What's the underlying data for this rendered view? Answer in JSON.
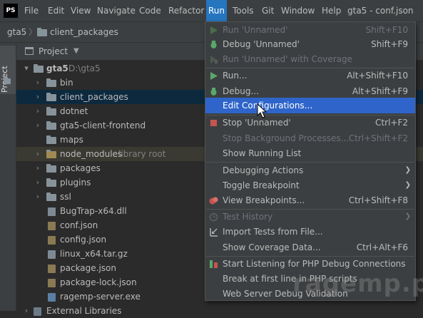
{
  "app": {
    "logo": "PS",
    "window_title": "gta5 - conf.json"
  },
  "menubar": [
    {
      "label": "File"
    },
    {
      "label": "Edit"
    },
    {
      "label": "View"
    },
    {
      "label": "Navigate"
    },
    {
      "label": "Code"
    },
    {
      "label": "Refactor"
    },
    {
      "label": "Run",
      "active": true
    },
    {
      "label": "Tools"
    },
    {
      "label": "Git"
    },
    {
      "label": "Window"
    },
    {
      "label": "Help"
    }
  ],
  "breadcrumb": {
    "root": "gta5",
    "child": "client_packages"
  },
  "side_strip": {
    "project_tab": "Project"
  },
  "project_panel": {
    "title": "Project"
  },
  "tree": [
    {
      "label": "gta5",
      "hint": "D:\\gta5",
      "type": "folder",
      "level": 0,
      "expanded": true
    },
    {
      "label": "bin",
      "type": "folder",
      "level": 1
    },
    {
      "label": "client_packages",
      "type": "folder",
      "level": 1,
      "selected": true
    },
    {
      "label": "dotnet",
      "type": "folder",
      "level": 1
    },
    {
      "label": "gta5-client-frontend",
      "type": "folder",
      "level": 1
    },
    {
      "label": "maps",
      "type": "folder",
      "level": 1,
      "no_arrow": true
    },
    {
      "label": "node_modules",
      "hint": "library root",
      "type": "folder",
      "level": 1,
      "excluded": true
    },
    {
      "label": "packages",
      "type": "folder",
      "level": 1
    },
    {
      "label": "plugins",
      "type": "folder",
      "level": 1
    },
    {
      "label": "ssl",
      "type": "folder",
      "level": 1
    },
    {
      "label": "BugTrap-x64.dll",
      "type": "file",
      "level": 1
    },
    {
      "label": "conf.json",
      "type": "json",
      "level": 1
    },
    {
      "label": "config.json",
      "type": "json",
      "level": 1
    },
    {
      "label": "linux_x64.tar.gz",
      "type": "file",
      "level": 1
    },
    {
      "label": "package.json",
      "type": "json",
      "level": 1
    },
    {
      "label": "package-lock.json",
      "type": "json",
      "level": 1
    },
    {
      "label": "ragemp-server.exe",
      "type": "exe",
      "level": 1
    },
    {
      "label": "External Libraries",
      "type": "lib",
      "level": 0
    }
  ],
  "run_menu": [
    {
      "label": "Run 'Unnamed'",
      "shortcut": "Shift+F10",
      "disabled": true,
      "icon": "run-icon"
    },
    {
      "label": "Debug 'Unnamed'",
      "shortcut": "Shift+F9",
      "icon": "debug-icon"
    },
    {
      "label": "Run 'Unnamed' with Coverage",
      "shortcut": "",
      "disabled": true,
      "icon": "coverage-icon"
    },
    {
      "separator": true
    },
    {
      "label": "Run...",
      "shortcut": "Alt+Shift+F10",
      "icon": "run-icon"
    },
    {
      "label": "Debug...",
      "shortcut": "Alt+Shift+F9",
      "icon": "debug-icon"
    },
    {
      "label": "Edit Configurations...",
      "shortcut": "",
      "highlighted": true
    },
    {
      "separator": true
    },
    {
      "label": "Stop 'Unnamed'",
      "shortcut": "Ctrl+F2",
      "icon": "stop-icon"
    },
    {
      "label": "Stop Background Processes...",
      "shortcut": "Ctrl+Shift+F2",
      "disabled": true
    },
    {
      "label": "Show Running List",
      "shortcut": ""
    },
    {
      "separator": true
    },
    {
      "label": "Debugging Actions",
      "shortcut": "",
      "submenu": true
    },
    {
      "label": "Toggle Breakpoint",
      "shortcut": "",
      "submenu": true
    },
    {
      "label": "View Breakpoints...",
      "shortcut": "Ctrl+Shift+F8",
      "icon": "breakpoints-icon"
    },
    {
      "separator": true
    },
    {
      "label": "Test History",
      "shortcut": "",
      "disabled": true,
      "submenu": true,
      "icon": "history-icon"
    },
    {
      "label": "Import Tests from File...",
      "shortcut": "",
      "icon": "import-icon"
    },
    {
      "label": "Show Coverage Data...",
      "shortcut": "Ctrl+Alt+F6"
    },
    {
      "separator": true
    },
    {
      "label": "Start Listening for PHP Debug Connections",
      "shortcut": "",
      "icon": "listen-icon"
    },
    {
      "label": "Break at first line in PHP scripts",
      "shortcut": ""
    },
    {
      "label": "Web Server Debug Validation",
      "shortcut": ""
    }
  ],
  "watermark": "ragemp.pro",
  "colors": {
    "accent": "#2675bf",
    "highlight": "#2f65ca",
    "selection": "#0d293e",
    "menu_bg": "#3c3f41",
    "editor_bg": "#2b2b2b"
  }
}
